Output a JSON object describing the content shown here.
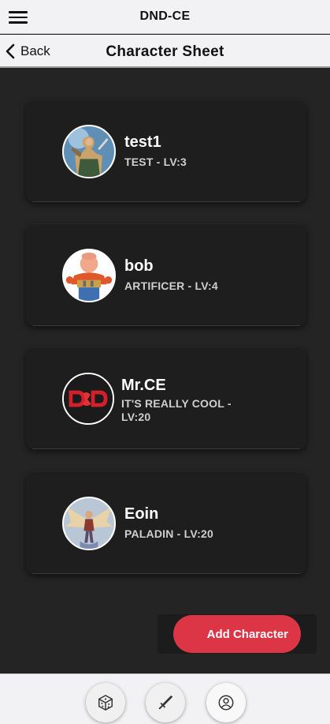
{
  "app": {
    "title": "DND-CE"
  },
  "nav": {
    "back_label": "Back",
    "title": "Character Sheet"
  },
  "characters": [
    {
      "name": "test1",
      "subtitle": "TEST - LV:3",
      "avatar_icon": "warrior-portrait-icon"
    },
    {
      "name": "bob",
      "subtitle": "ARTIFICER - LV:4",
      "avatar_icon": "builder-portrait-icon"
    },
    {
      "name": "Mr.CE",
      "subtitle": "IT'S REALLY COOL - LV:20",
      "avatar_icon": "dnd-logo-icon"
    },
    {
      "name": "Eoin",
      "subtitle": "PALADIN - LV:20",
      "avatar_icon": "winged-paladin-portrait-icon"
    }
  ],
  "actions": {
    "add_character_label": "Add Character"
  },
  "tabs": [
    {
      "icon": "dice-icon"
    },
    {
      "icon": "sword-icon"
    },
    {
      "icon": "user-icon",
      "active": true
    }
  ],
  "colors": {
    "accent": "#dc3545",
    "background": "#242424",
    "card": "#1e1e1e",
    "bar": "#f2f2f5"
  }
}
